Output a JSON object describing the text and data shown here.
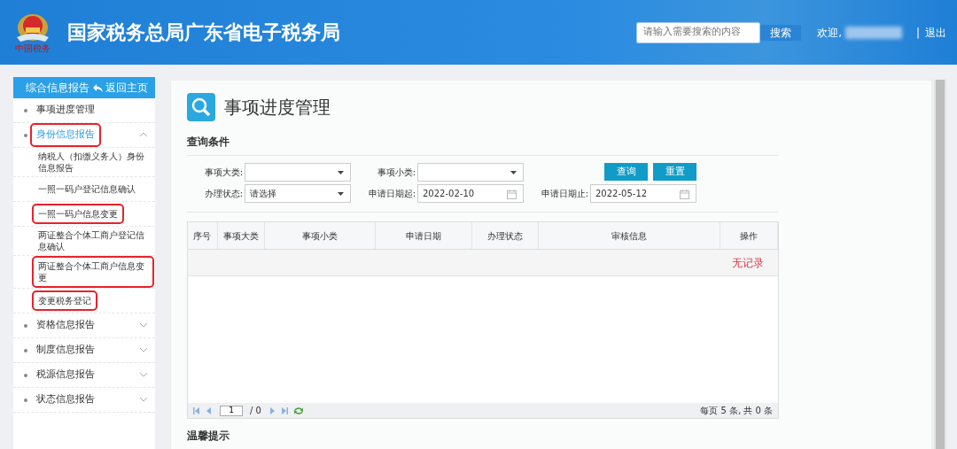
{
  "header": {
    "title": "国家税务总局广东省电子税务局",
    "logo_caption": "中国税务",
    "search": {
      "placeholder": "请输入需要搜索的内容"
    },
    "search_button": "搜索",
    "welcome": "欢迎,",
    "separator": "|",
    "logout": "退出"
  },
  "sidebar": {
    "title": "综合信息报告",
    "back": "返回主页",
    "items": [
      {
        "label": "事项进度管理",
        "kind": "link",
        "selected": false,
        "highlighted": false
      },
      {
        "label": "身份信息报告",
        "kind": "group",
        "selected": true,
        "expanded": true,
        "highlighted": true,
        "children": [
          {
            "label": "纳税人（扣缴义务人）身份信息报告",
            "selected": false,
            "highlighted": false
          },
          {
            "label": "一照一码户登记信息确认",
            "selected": false,
            "highlighted": false
          },
          {
            "label": "一照一码户信息变更",
            "selected": false,
            "highlighted": true
          },
          {
            "label": "两证整合个体工商户登记信息确认",
            "selected": false,
            "highlighted": false
          },
          {
            "label": "两证整合个体工商户信息变更",
            "selected": false,
            "highlighted": true
          },
          {
            "label": "变更税务登记",
            "selected": false,
            "highlighted": true
          }
        ]
      },
      {
        "label": "资格信息报告",
        "kind": "group",
        "selected": false,
        "expanded": false,
        "highlighted": false
      },
      {
        "label": "制度信息报告",
        "kind": "group",
        "selected": false,
        "expanded": false,
        "highlighted": false
      },
      {
        "label": "税源信息报告",
        "kind": "group",
        "selected": false,
        "expanded": false,
        "highlighted": false
      },
      {
        "label": "状态信息报告",
        "kind": "group",
        "selected": false,
        "expanded": false,
        "highlighted": false
      }
    ]
  },
  "main": {
    "title": "事项进度管理",
    "query_heading": "查询条件",
    "fields": [
      {
        "label": "事项大类:",
        "kind": "select"
      },
      {
        "label": "事项小类:",
        "kind": "select"
      },
      {
        "label": "办理状态:",
        "kind": "select",
        "value": "请选择"
      },
      {
        "label": "申请日期起:",
        "kind": "date",
        "value": "2022-02-10"
      },
      {
        "label": "申请日期止:",
        "kind": "date",
        "value": "2022-05-12"
      }
    ],
    "buttons": [
      "查询",
      "重置"
    ],
    "table": {
      "columns": [
        "序号",
        "事项大类",
        "事项小类",
        "申请日期",
        "办理状态",
        "审核信息",
        "操作"
      ],
      "empty_message": "无记录"
    },
    "pager": {
      "page": "1",
      "total": "/ 0",
      "summary": "每页 5 条, 共 0 条"
    },
    "tips_heading": "温馨提示"
  }
}
